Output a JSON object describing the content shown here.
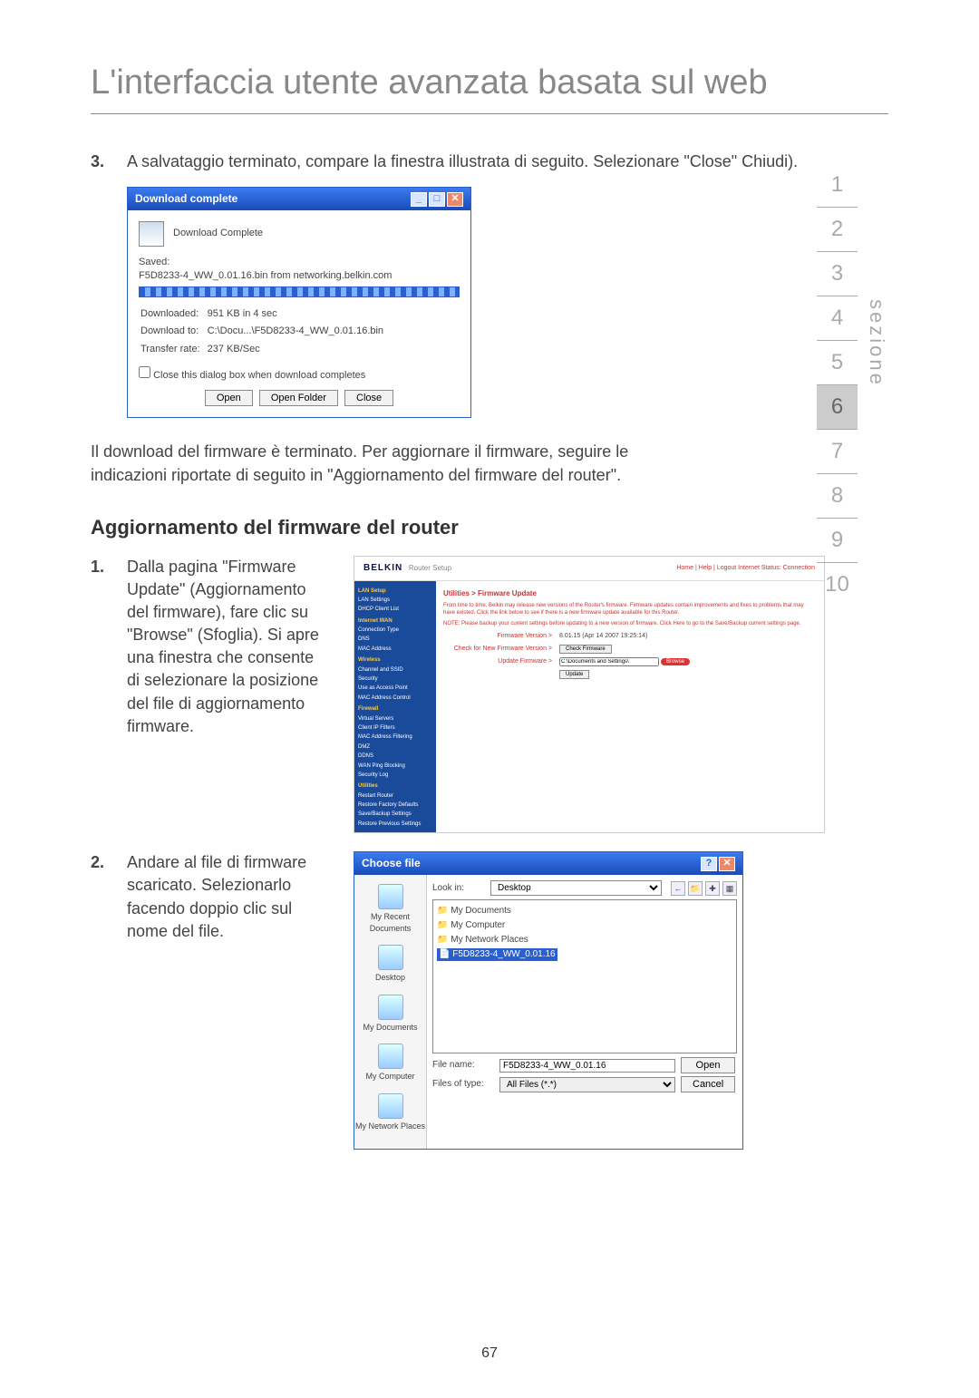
{
  "title": "L'interfaccia utente avanzata basata sul web",
  "nav": {
    "label": "sezione",
    "items": [
      "1",
      "2",
      "3",
      "4",
      "5",
      "6",
      "7",
      "8",
      "9",
      "10"
    ],
    "active": "6"
  },
  "step3": {
    "num": "3.",
    "text": "A salvataggio terminato, compare la finestra illustrata di seguito. Selezionare \"Close\" Chiudi)."
  },
  "dlwin": {
    "title": "Download complete",
    "heading": "Download Complete",
    "saved_label": "Saved:",
    "saved_value": "F5D8233-4_WW_0.01.16.bin from networking.belkin.com",
    "rows": [
      {
        "k": "Downloaded:",
        "v": "951 KB in 4 sec"
      },
      {
        "k": "Download to:",
        "v": "C:\\Docu...\\F5D8233-4_WW_0.01.16.bin"
      },
      {
        "k": "Transfer rate:",
        "v": "237 KB/Sec"
      }
    ],
    "checkbox": "Close this dialog box when download completes",
    "open": "Open",
    "open_folder": "Open Folder",
    "close": "Close"
  },
  "para_after": "Il download del firmware è terminato. Per aggiornare il firmware, seguire le indicazioni riportate di seguito in \"Aggiornamento del firmware del router\".",
  "subheading": "Aggiornamento del firmware del router",
  "step1": {
    "num": "1.",
    "text": "Dalla pagina \"Firmware Update\" (Aggiornamento del firmware), fare clic su \"Browse\" (Sfoglia). Si apre una finestra che consente di selezionare la posizione del file di aggiornamento firmware."
  },
  "step2": {
    "num": "2.",
    "text": "Andare al file di firmware scaricato. Selezionarlo facendo doppio clic sul nome del file."
  },
  "belkin": {
    "brand": "BELKIN",
    "sub": "Router Setup",
    "links": "Home | Help | Logout    Internet Status: Connection",
    "side_groups": [
      {
        "head": "LAN Setup",
        "items": [
          "LAN Settings",
          "DHCP Client List"
        ]
      },
      {
        "head": "Internet WAN",
        "items": [
          "Connection Type",
          "DNS",
          "MAC Address"
        ]
      },
      {
        "head": "Wireless",
        "items": [
          "Channel and SSID",
          "Security",
          "Use as Access Point",
          "MAC Address Control"
        ]
      },
      {
        "head": "Firewall",
        "items": [
          "Virtual Servers",
          "Client IP Filters",
          "MAC Address Filtering",
          "DMZ",
          "DDNS",
          "WAN Ping Blocking",
          "Security Log"
        ]
      },
      {
        "head": "Utilities",
        "items": [
          "Restart Router",
          "Restore Factory Defaults",
          "Save/Backup Settings",
          "Restore Previous Settings"
        ]
      }
    ],
    "crumb": "Utilities > Firmware Update",
    "note1": "From time to time, Belkin may release new versions of the Router's firmware. Firmware updates contain improvements and fixes to problems that may have existed. Click the link below to see if there is a new firmware update available for this Router.",
    "note2": "NOTE: Please backup your current settings before updating to a new version of firmware. Click Here to go to the Save/Backup current settings page.",
    "fw_ver_lbl": "Firmware Version >",
    "fw_ver_val": "8.01.15 (Apr 14 2007 19:25:14)",
    "check_lbl": "Check for New Firmware Version >",
    "check_btn": "Check Firmware",
    "update_lbl": "Update Firmware >",
    "update_path": "C:\\Documents and Settings\\",
    "browse": "Browse",
    "update_btn": "Update"
  },
  "choose": {
    "title": "Choose file",
    "lookin_lbl": "Look in:",
    "lookin_val": "Desktop",
    "places": [
      "My Recent Documents",
      "Desktop",
      "My Documents",
      "My Computer",
      "My Network Places"
    ],
    "list": [
      {
        "t": "folder",
        "name": "My Documents"
      },
      {
        "t": "folder",
        "name": "My Computer"
      },
      {
        "t": "folder",
        "name": "My Network Places"
      },
      {
        "t": "file",
        "name": "F5D8233-4_WW_0.01.16",
        "sel": true
      }
    ],
    "filename_lbl": "File name:",
    "filename_val": "F5D8233-4_WW_0.01.16",
    "filetype_lbl": "Files of type:",
    "filetype_val": "All Files (*.*)",
    "open": "Open",
    "cancel": "Cancel"
  },
  "pagenum": "67"
}
